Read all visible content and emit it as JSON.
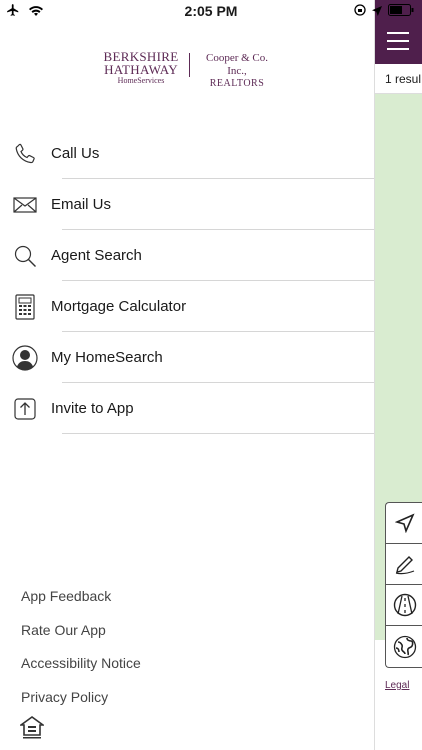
{
  "status_bar": {
    "time": "2:05 PM"
  },
  "logo": {
    "brand_line1": "BERKSHIRE",
    "brand_line2": "HATHAWAY",
    "brand_line3": "HomeServices",
    "office_line1": "Cooper & Co. Inc.,",
    "office_line2": "REALTORS"
  },
  "menu": {
    "items": [
      {
        "label": "Call Us",
        "icon": "phone-icon"
      },
      {
        "label": "Email Us",
        "icon": "envelope-icon"
      },
      {
        "label": "Agent Search",
        "icon": "search-icon"
      },
      {
        "label": "Mortgage Calculator",
        "icon": "calculator-icon"
      },
      {
        "label": "My HomeSearch",
        "icon": "user-icon"
      },
      {
        "label": "Invite to App",
        "icon": "share-icon"
      }
    ]
  },
  "footer": {
    "links": [
      "App Feedback",
      "Rate Our App",
      "Accessibility Notice",
      "Privacy Policy"
    ]
  },
  "map_panel": {
    "results_text": "1 resul",
    "legal_label": "Legal"
  },
  "colors": {
    "brand": "#5d2a55",
    "topbar": "#4f1f4c",
    "map": "#d9ecd0"
  }
}
